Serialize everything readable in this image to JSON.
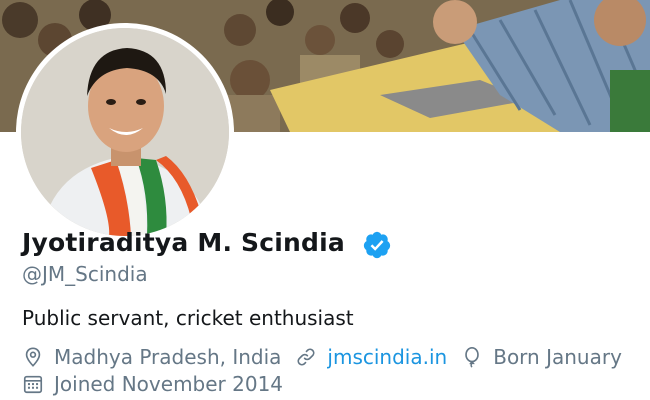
{
  "profile": {
    "display_name": "Jyotiraditya M. Scindia",
    "handle": "@JM_Scindia",
    "bio": "Public servant, cricket enthusiast",
    "location": "Madhya Pradesh, India",
    "website": "jmscindia.in",
    "birthday": "Born January",
    "joined": "Joined November 2014",
    "verified": true
  },
  "icons": {
    "verified": "verified-badge-icon",
    "location": "location-pin-icon",
    "website": "link-icon",
    "birthday": "balloon-icon",
    "joined": "calendar-icon"
  },
  "colors": {
    "verified": "#1da1f2",
    "link": "#1b95e0",
    "secondary_text": "#657786",
    "primary_text": "#14171a"
  }
}
